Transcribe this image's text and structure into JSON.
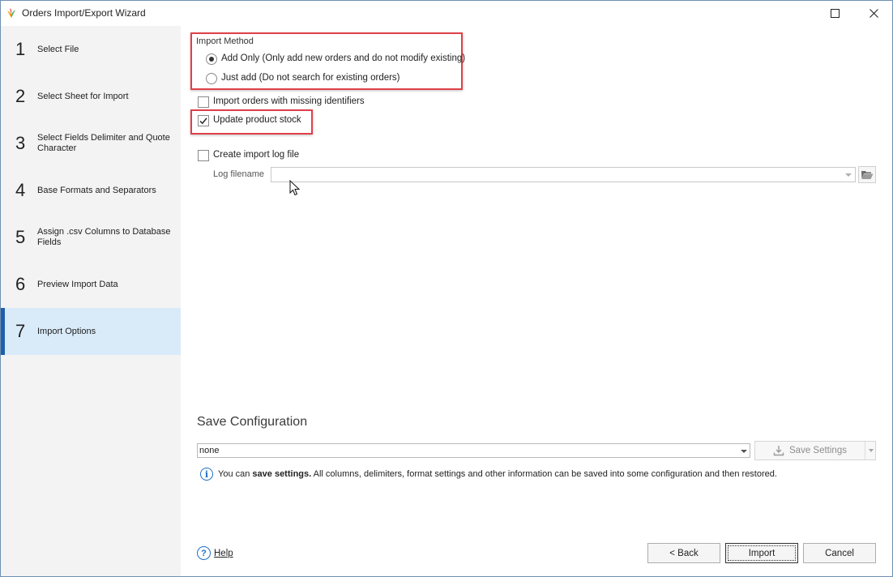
{
  "window": {
    "title": "Orders Import/Export Wizard"
  },
  "sidebar": {
    "steps": [
      {
        "number": "1",
        "label": "Select File"
      },
      {
        "number": "2",
        "label": "Select Sheet for Import"
      },
      {
        "number": "3",
        "label": "Select Fields Delimiter and Quote Character"
      },
      {
        "number": "4",
        "label": "Base Formats and Separators"
      },
      {
        "number": "5",
        "label": "Assign .csv Columns to Database Fields"
      },
      {
        "number": "6",
        "label": "Preview Import Data"
      },
      {
        "number": "7",
        "label": "Import Options"
      }
    ],
    "active_step": 7
  },
  "import_method": {
    "title": "Import Method",
    "options": [
      {
        "label": "Add Only (Only add new orders and do not modify existing)",
        "selected": true
      },
      {
        "label": "Just add (Do not search for existing orders)",
        "selected": false
      }
    ]
  },
  "options": {
    "missing_identifiers": {
      "label": "Import orders with missing identifiers",
      "checked": false
    },
    "update_stock": {
      "label": "Update product stock",
      "checked": true
    },
    "create_log": {
      "label": "Create import log file",
      "checked": false
    },
    "log_filename_label": "Log filename",
    "log_filename_value": ""
  },
  "save_configuration": {
    "title": "Save Configuration",
    "selected": "none",
    "save_button": "Save Settings",
    "info_prefix": "You can ",
    "info_bold": "save settings.",
    "info_suffix": " All columns, delimiters, format settings and other information can be saved into some configuration and then restored."
  },
  "footer": {
    "help": "Help",
    "back": "< Back",
    "import": "Import",
    "cancel": "Cancel"
  },
  "colors": {
    "highlight": "#e0404a",
    "active_step_bg": "#d9ebf9",
    "active_step_bar": "#1f5fa8",
    "info_blue": "#1d6fc4"
  }
}
